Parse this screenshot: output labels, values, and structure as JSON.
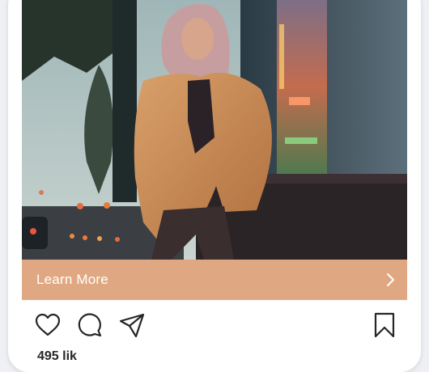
{
  "post": {
    "image": {
      "subject": "woman in teddy coat sitting outside neon-lit storefront at dusk",
      "accent_color": "#e0a882"
    },
    "cta": {
      "label": "Learn More",
      "icon": "chevron-right-icon"
    },
    "actions": [
      {
        "icon": "heart-icon",
        "label": "Like"
      },
      {
        "icon": "comment-icon",
        "label": "Comment"
      },
      {
        "icon": "share-icon",
        "label": "Share"
      },
      {
        "icon": "bookmark-icon",
        "label": "Save"
      }
    ],
    "likes_text": "495 lik"
  }
}
